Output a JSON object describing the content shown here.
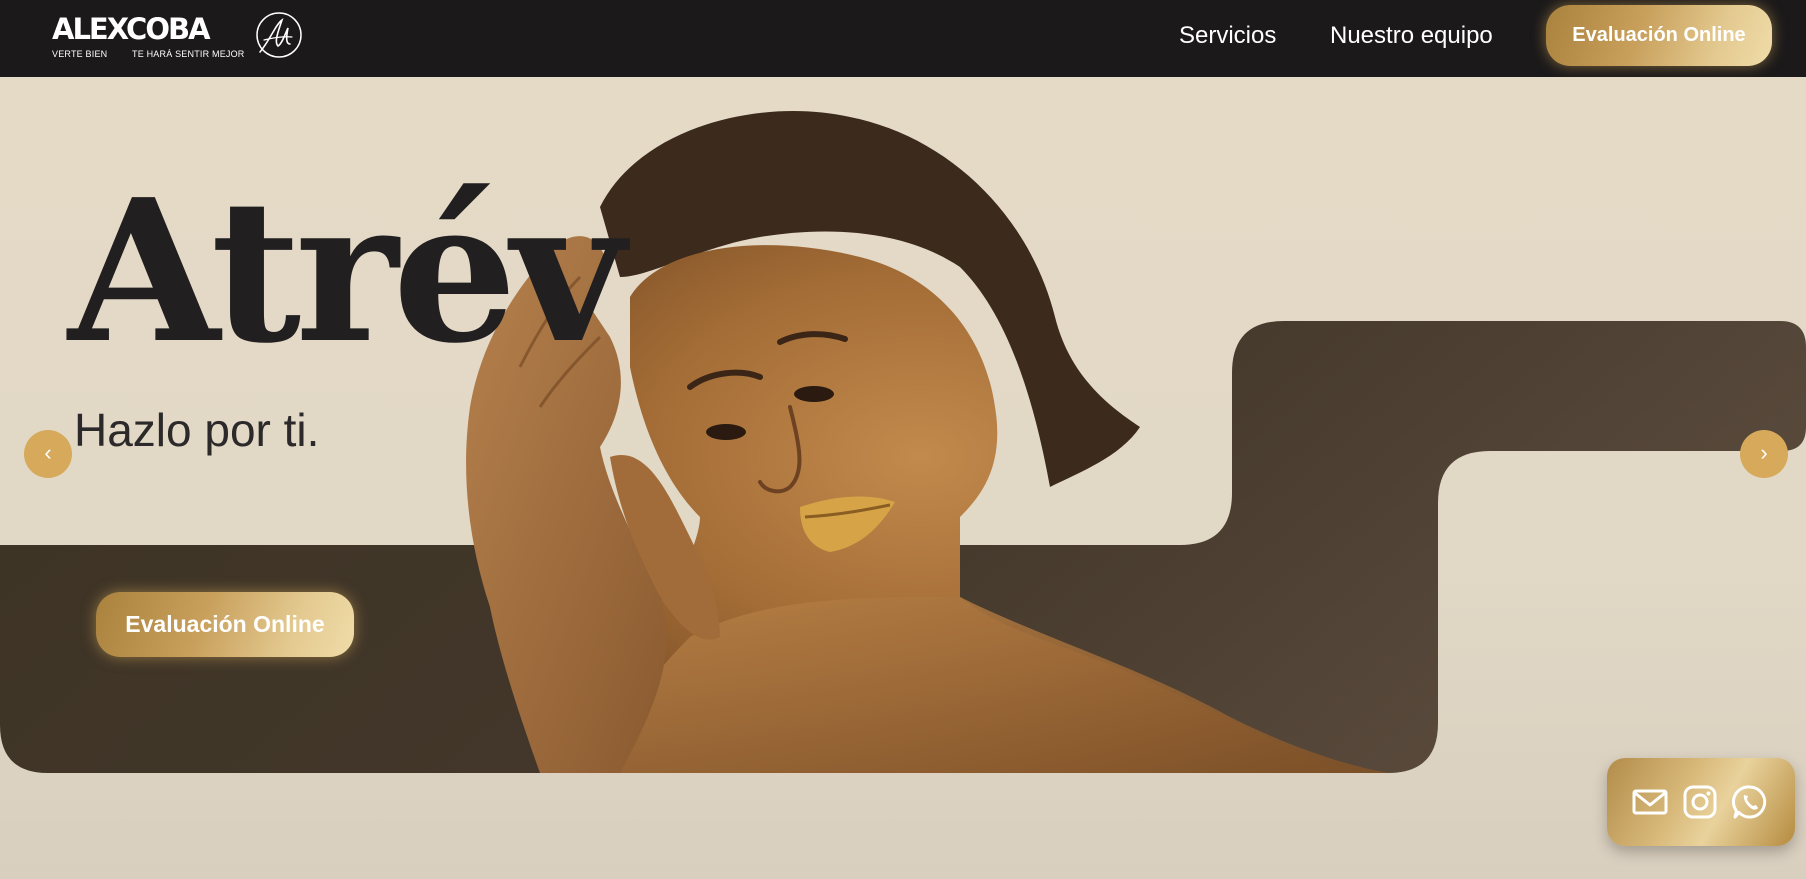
{
  "header": {
    "logo": {
      "wordmark": "ALEXCOBA",
      "tagline_left": "VERTE BIEN",
      "tagline_right": "TE HARÁ SENTIR MEJOR",
      "monogram_icon": "ac-monogram-icon"
    },
    "nav": [
      {
        "label": "Servicios"
      },
      {
        "label": "Nuestro equipo"
      }
    ],
    "cta_label": "Evaluación Online"
  },
  "hero": {
    "headline": "Atrév",
    "subheadline": "Hazlo por ti.",
    "cta_label": "Evaluación Online",
    "prev_arrow": "‹",
    "next_arrow": "›",
    "image": "portrait of woman with gold-painted skin and lips"
  },
  "contact_widget": {
    "icons": [
      "mail-icon",
      "instagram-icon",
      "whatsapp-icon"
    ]
  },
  "colors": {
    "topbar": "#1b191a",
    "gold_accent": "#d6a95b",
    "dark_band": "#3e3426",
    "background": "#e2d8c6",
    "text_dark": "#221f21"
  }
}
